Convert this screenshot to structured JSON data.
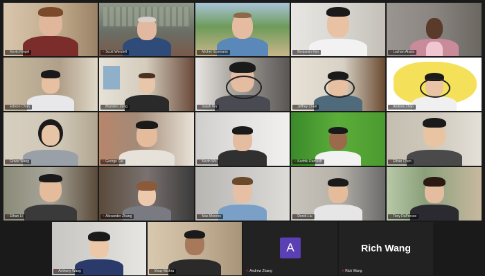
{
  "meeting": {
    "participants": [
      {
        "name": "Kevin Ringel",
        "bg": "#c9b49a",
        "shirt": "#7a2d2a",
        "skin": "#e0b79a",
        "hair": "#7a4a2a"
      },
      {
        "name": "Scott Wendell",
        "bg": "#7f8a7c",
        "shirt": "#2f4b7a",
        "skin": "#e2b9a0",
        "hair": "#d8d0c8"
      },
      {
        "name": "Michel Gosmann",
        "bg": "#6e9b5a",
        "shirt": "#5a88b8",
        "skin": "#e6bca0",
        "hair": "#8a6a4a"
      },
      {
        "name": "Benjamin Kim",
        "bg": "#d9d7d2",
        "shirt": "#f2f2f2",
        "skin": "#e8c2a2",
        "hair": "#1a1a1a"
      },
      {
        "name": "Lushan Abara",
        "bg": "#8a8580",
        "shirt": "#c98a9a",
        "skin": "#5a3a2a",
        "hair": "#1a1a1a"
      },
      {
        "name": "Edison Chan",
        "bg": "#b0a08a",
        "shirt": "#e8e8ea",
        "skin": "#e6c0a0",
        "hair": "#1a1a1a"
      },
      {
        "name": "Brandon Zeng",
        "bg": "#d4ccbc",
        "shirt": "#2a2a2a",
        "skin": "#e8c6aa",
        "hair": "#4a3020"
      },
      {
        "name": "Isaiah Wu",
        "bg": "#8f8c88",
        "shirt": "#4a4a52",
        "skin": "#e4bca0",
        "hair": "#1a1a1a"
      },
      {
        "name": "Jeffrey Chen",
        "bg": "#d8d2c6",
        "shirt": "#4f6a7a",
        "skin": "#e6c0a0",
        "hair": "#1a1a1a"
      },
      {
        "name": "Andrew Zhao",
        "bg": "#f5e05a",
        "shirt": "#f0f0f0",
        "skin": "#e8c4a4",
        "hair": "#1a1a1a"
      },
      {
        "name": "Grace Wang",
        "bg": "#cfc6b6",
        "shirt": "#9aa0a8",
        "skin": "#e8c4a6",
        "hair": "#1a1a1a"
      },
      {
        "name": "George Cai",
        "bg": "#a38a78",
        "shirt": "#e6e2da",
        "skin": "#e4bc9c",
        "hair": "#1a1a1a"
      },
      {
        "name": "Kevin Wu",
        "bg": "#e4e2e0",
        "shirt": "#303030",
        "skin": "#e4bca0",
        "hair": "#1a1a1a"
      },
      {
        "name": "Karthik Ramesh",
        "bg": "#5cae3a",
        "shirt": "#f2f2f2",
        "skin": "#9a6a4a",
        "hair": "#1a1a1a"
      },
      {
        "name": "Ethan Chen",
        "bg": "#cfc9bd",
        "shirt": "#4a4a4a",
        "skin": "#e8c4a2",
        "hair": "#1a1a1a"
      },
      {
        "name": "Ethan Li",
        "bg": "#a8a69a",
        "shirt": "#3a3a3a",
        "skin": "#e4bc9c",
        "hair": "#1a1a1a"
      },
      {
        "name": "Alexander Zhang",
        "bg": "#7a7270",
        "shirt": "#7a7a82",
        "skin": "#ecc8ac",
        "hair": "#8a5a3a"
      },
      {
        "name": "Max Moreno",
        "bg": "#cac8c6",
        "shirt": "#7aa0c8",
        "skin": "#e6c0a4",
        "hair": "#6a4a2a"
      },
      {
        "name": "Derek Liu",
        "bg": "#b6b2aa",
        "shirt": "#e6e6e6",
        "skin": "#e4bc9c",
        "hair": "#1a1a1a"
      },
      {
        "name": "Tony DuPresse",
        "bg": "#8aa07a",
        "shirt": "#2a2a30",
        "skin": "#e4bca0",
        "hair": "#2a1a12"
      },
      {
        "name": "Anthony Wang",
        "bg": "#d6d4d0",
        "shirt": "#2a3a6a",
        "skin": "#ecc8a8",
        "hair": "#1a1a1a"
      },
      {
        "name": "Vinay Mishra",
        "bg": "#c6b49a",
        "shirt": "#2a2a2a",
        "skin": "#a8785a",
        "hair": "#1a1a1a"
      },
      {
        "name": "Andrew Zhang",
        "avatar_letter": "A",
        "avatar_color": "#5b3fb5"
      },
      {
        "name": "Rich Wang",
        "display_name": "Rich Wang"
      }
    ]
  }
}
